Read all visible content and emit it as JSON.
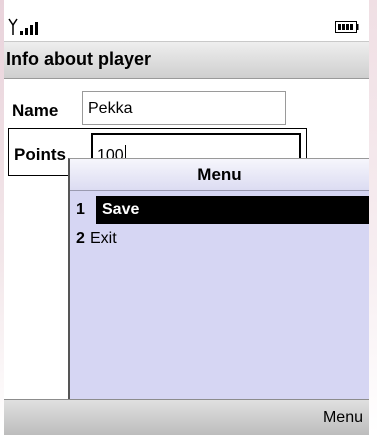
{
  "status_bar": {
    "signal_icon": "signal-strength-icon",
    "battery_icon": "battery-icon"
  },
  "title": "Info about player",
  "form": {
    "name_label": "Name",
    "name_value": "Pekka",
    "points_label": "Points",
    "points_value": "100"
  },
  "menu": {
    "title": "Menu",
    "items": [
      {
        "number": "1",
        "label": "Save",
        "selected": true
      },
      {
        "number": "2",
        "label": "Exit",
        "selected": false
      }
    ]
  },
  "softkeys": {
    "right": "Menu"
  },
  "colors": {
    "menu_bg": "#d6d6f3",
    "highlight": "#000000",
    "title_bar": "#d8d8d8"
  }
}
